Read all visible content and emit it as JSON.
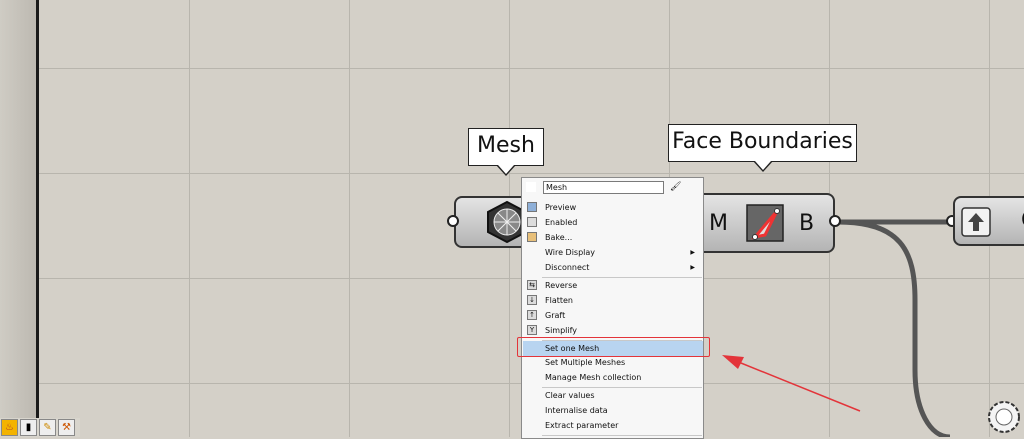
{
  "canvas": {
    "components": {
      "mesh": {
        "tooltip": "Mesh",
        "icon": "mesh-sphere-icon"
      },
      "face_boundaries": {
        "tooltip": "Face Boundaries",
        "input_label": "M",
        "output_label": "B",
        "icon": "face-boundary-icon"
      },
      "next_component": {
        "label": "C",
        "icon": "upload-arrow-icon"
      }
    }
  },
  "context_menu": {
    "name_value": "Mesh",
    "items_group1": [
      {
        "label": "Preview",
        "icon": "preview-icon",
        "submenu": false
      },
      {
        "label": "Enabled",
        "icon": "enabled-icon",
        "submenu": false
      },
      {
        "label": "Bake...",
        "icon": "bake-icon",
        "submenu": false
      },
      {
        "label": "Wire Display",
        "icon": "",
        "submenu": true
      },
      {
        "label": "Disconnect",
        "icon": "",
        "submenu": true
      }
    ],
    "items_group2": [
      {
        "label": "Reverse",
        "icon": "reverse-icon"
      },
      {
        "label": "Flatten",
        "icon": "flatten-icon"
      },
      {
        "label": "Graft",
        "icon": "graft-icon"
      },
      {
        "label": "Simplify",
        "icon": "simplify-icon"
      }
    ],
    "items_group3": [
      {
        "label": "Set one Mesh"
      },
      {
        "label": "Set Multiple Meshes"
      },
      {
        "label": "Manage Mesh collection"
      }
    ],
    "items_group4": [
      {
        "label": "Clear values"
      },
      {
        "label": "Internalise data"
      },
      {
        "label": "Extract parameter"
      }
    ]
  },
  "colors": {
    "canvas_bg": "#d4d0c8",
    "highlight": "#b8d4f0",
    "annotation_red": "#e3343a"
  }
}
